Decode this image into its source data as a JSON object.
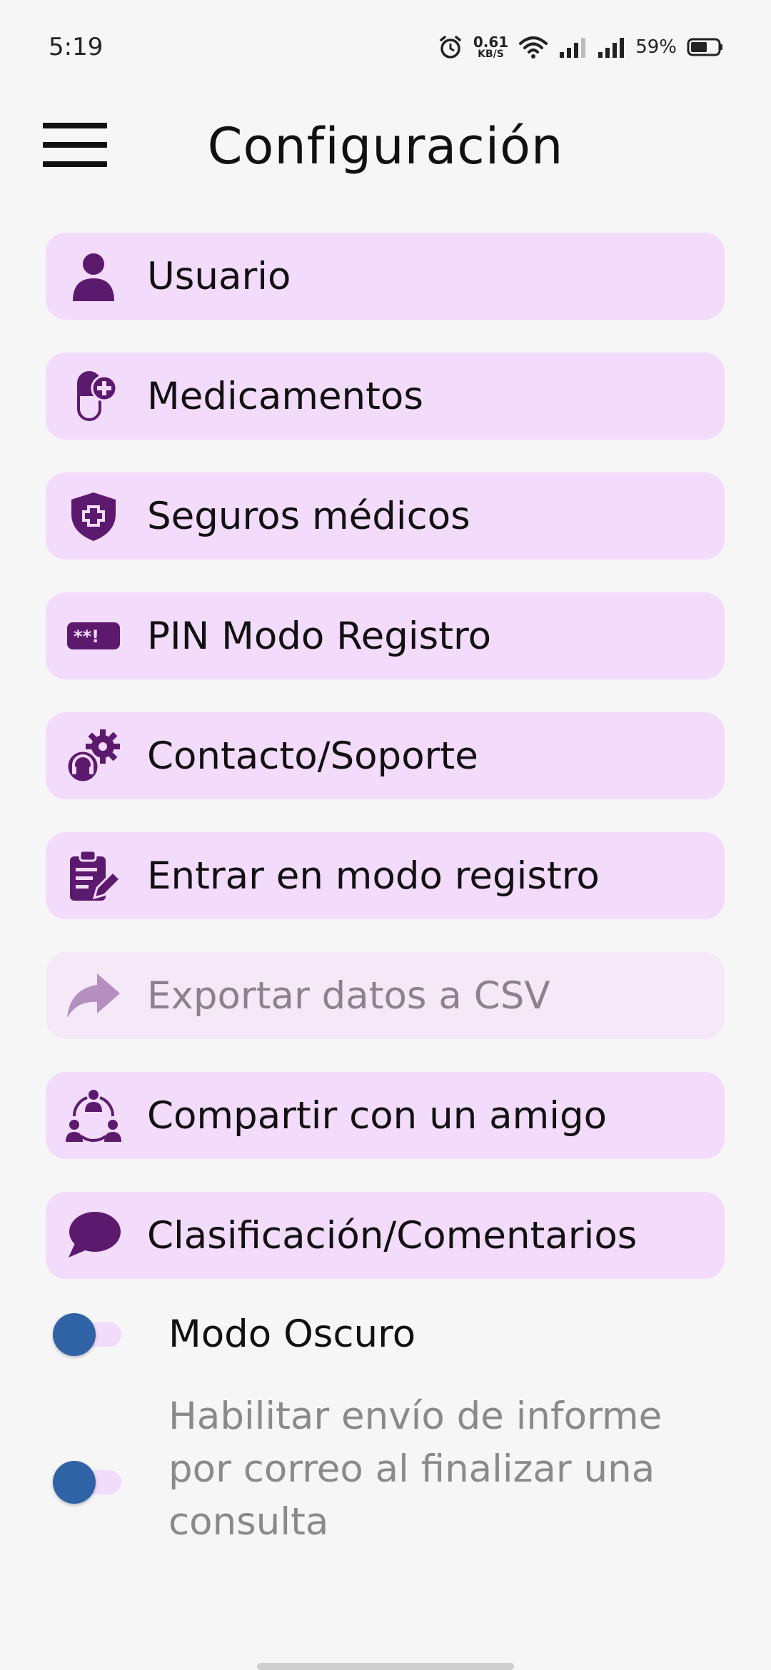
{
  "status_bar": {
    "time": "5:19",
    "net_speed_value": "0.61",
    "net_speed_unit": "KB/S",
    "battery": "59%"
  },
  "app_bar": {
    "title": "Configuración"
  },
  "menu": [
    {
      "label": "Usuario",
      "icon": "user-icon",
      "enabled": true
    },
    {
      "label": "Medicamentos",
      "icon": "pill-icon",
      "enabled": true
    },
    {
      "label": "Seguros médicos",
      "icon": "shield-plus-icon",
      "enabled": true
    },
    {
      "label": "PIN Modo Registro",
      "icon": "pin-icon",
      "enabled": true
    },
    {
      "label": "Contacto/Soporte",
      "icon": "support-gear-icon",
      "enabled": true
    },
    {
      "label": "Entrar en modo registro",
      "icon": "clipboard-edit-icon",
      "enabled": true
    },
    {
      "label": "Exportar datos a CSV",
      "icon": "share-arrow-icon",
      "enabled": false
    },
    {
      "label": "Compartir con un amigo",
      "icon": "share-people-icon",
      "enabled": true
    },
    {
      "label": "Clasificación/Comentarios",
      "icon": "comment-icon",
      "enabled": true
    }
  ],
  "toggles": {
    "dark_mode": {
      "label": "Modo Oscuro",
      "on": false
    },
    "email_report": {
      "label": "Habilitar envío de informe por correo al finalizar una consulta",
      "on": false
    }
  },
  "colors": {
    "accent": "#5c1a6e",
    "item_bg": "#f3dbfb",
    "item_bg_disabled": "#f5e9f8",
    "toggle_thumb": "#2f63a6"
  }
}
